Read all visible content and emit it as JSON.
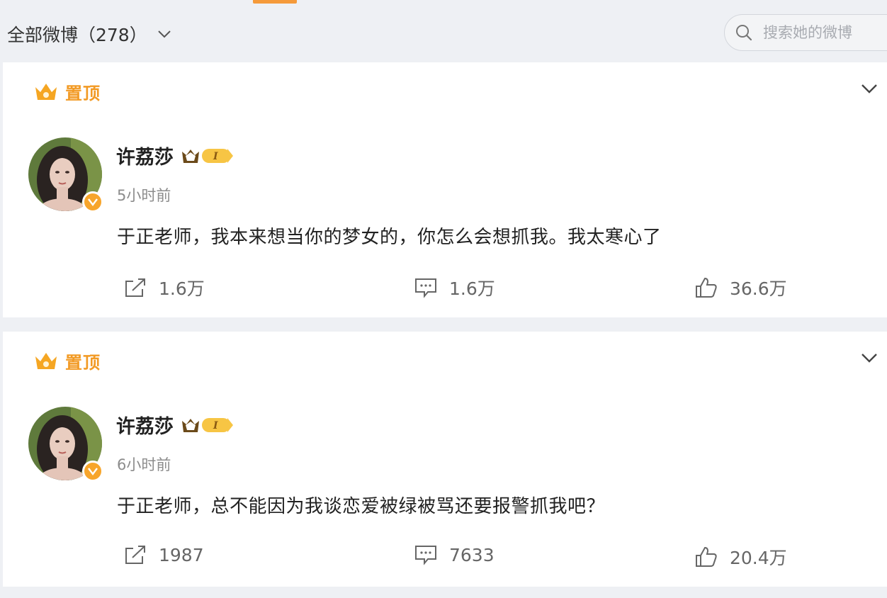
{
  "filter": {
    "label": "全部微博（278）"
  },
  "search": {
    "placeholder": "搜索她的微博"
  },
  "colors": {
    "accent": "#f29a24",
    "verified": "#f7a52b",
    "background": "#eef0f4"
  },
  "posts": [
    {
      "pinned_label": "置顶",
      "user": {
        "name": "许荔莎",
        "vip_level": "I"
      },
      "time": "5小时前",
      "text": "于正老师，我本来想当你的梦女的，你怎么会想抓我。我太寒心了",
      "shares": "1.6万",
      "comments": "1.6万",
      "likes": "36.6万",
      "icons": {
        "share": "share-icon",
        "comment": "comment-icon",
        "like": "thumbs-up-icon"
      }
    },
    {
      "pinned_label": "置顶",
      "user": {
        "name": "许荔莎",
        "vip_level": "I"
      },
      "time": "6小时前",
      "text": "于正老师，总不能因为我谈恋爱被绿被骂还要报警抓我吧？",
      "shares": "1987",
      "comments": "7633",
      "likes": "20.4万",
      "icons": {
        "share": "share-icon",
        "comment": "comment-icon",
        "like": "thumbs-up-icon"
      }
    }
  ]
}
